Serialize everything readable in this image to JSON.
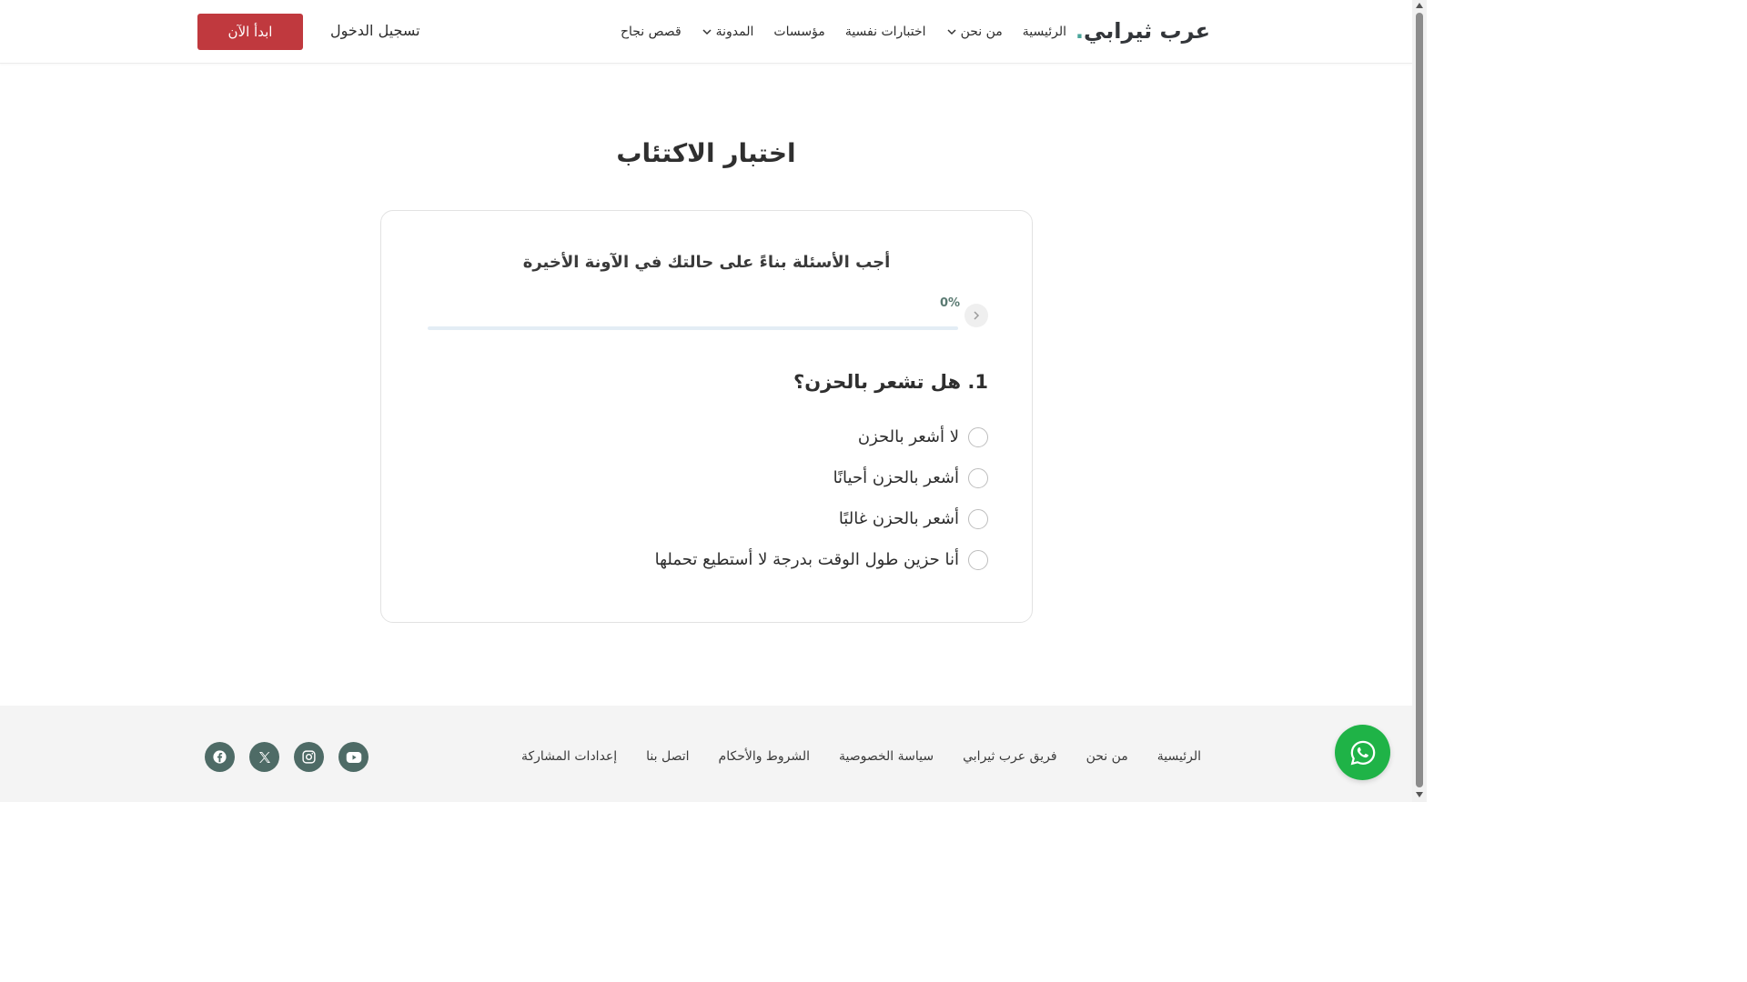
{
  "header": {
    "logo_text": "عرب ثيرابي",
    "logo_dot": ".",
    "nav": [
      {
        "label": "الرئيسية",
        "dropdown": false
      },
      {
        "label": "من نحن",
        "dropdown": true
      },
      {
        "label": "اختبارات نفسية",
        "dropdown": false
      },
      {
        "label": "مؤسسات",
        "dropdown": false
      },
      {
        "label": "المدونة",
        "dropdown": true
      },
      {
        "label": "قصص نجاح",
        "dropdown": false
      }
    ],
    "login_label": "تسجيل الدخول",
    "start_label": "ابدأ الآن"
  },
  "main": {
    "title": "اختبار الاكتئاب",
    "subtitle": "أجب الأسئلة بناءً على حالتك في الآونة الأخيرة",
    "progress_label": "0%",
    "progress_fraction": 0,
    "question": "1. هل تشعر بالحزن؟",
    "options": [
      "لا أشعر بالحزن",
      "أشعر بالحزن أحيانًا",
      "أشعر بالحزن غالبًا",
      "أنا حزين طول الوقت بدرجة لا أستطيع تحملها"
    ]
  },
  "footer": {
    "links": [
      "الرئيسية",
      "من نحن",
      "فريق عرب ثيرابي",
      "سياسة الخصوصية",
      "الشروط والأحكام",
      "اتصل بنا",
      "إعدادات المشاركة"
    ],
    "socials": [
      "youtube-icon",
      "instagram-icon",
      "x-icon",
      "facebook-icon"
    ]
  },
  "colors": {
    "accent": "#c0393e",
    "brand": "#4aa59a",
    "whatsapp": "#1fb347",
    "social_bg": "#4e6b66"
  }
}
